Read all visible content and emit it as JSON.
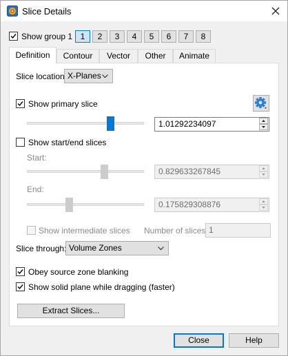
{
  "window": {
    "title": "Slice Details"
  },
  "group": {
    "show_label": "Show group 1",
    "show_checked": true,
    "buttons": [
      "1",
      "2",
      "3",
      "4",
      "5",
      "6",
      "7",
      "8"
    ],
    "active": "1"
  },
  "tabs": [
    "Definition",
    "Contour",
    "Vector",
    "Other",
    "Animate"
  ],
  "active_tab": "Definition",
  "slice_location": {
    "label": "Slice location:",
    "value": "X-Planes"
  },
  "primary": {
    "label": "Show primary slice",
    "checked": true,
    "value": "1.01292234097",
    "slider_fraction": 0.73
  },
  "startend": {
    "label": "Show start/end slices",
    "checked": false,
    "start_label": "Start:",
    "start_value": "0.829633267845",
    "start_fraction": 0.67,
    "end_label": "End:",
    "end_value": "0.175829308876",
    "end_fraction": 0.35
  },
  "intermediate": {
    "label": "Show intermediate slices",
    "checked": false,
    "num_label": "Number of slices:",
    "num_value": "1"
  },
  "slice_through": {
    "label": "Slice through:",
    "value": "Volume Zones"
  },
  "obey": {
    "label": "Obey source zone blanking",
    "checked": true
  },
  "solid": {
    "label": "Show solid plane while dragging (faster)",
    "checked": true
  },
  "extract_button": "Extract Slices...",
  "footer": {
    "close": "Close",
    "help": "Help"
  },
  "icons": {
    "app": "tecplot-app-icon",
    "settings": "gear-icon",
    "close": "close-icon"
  },
  "colors": {
    "accent": "#0078d7",
    "gear": "#2a7fd4"
  }
}
